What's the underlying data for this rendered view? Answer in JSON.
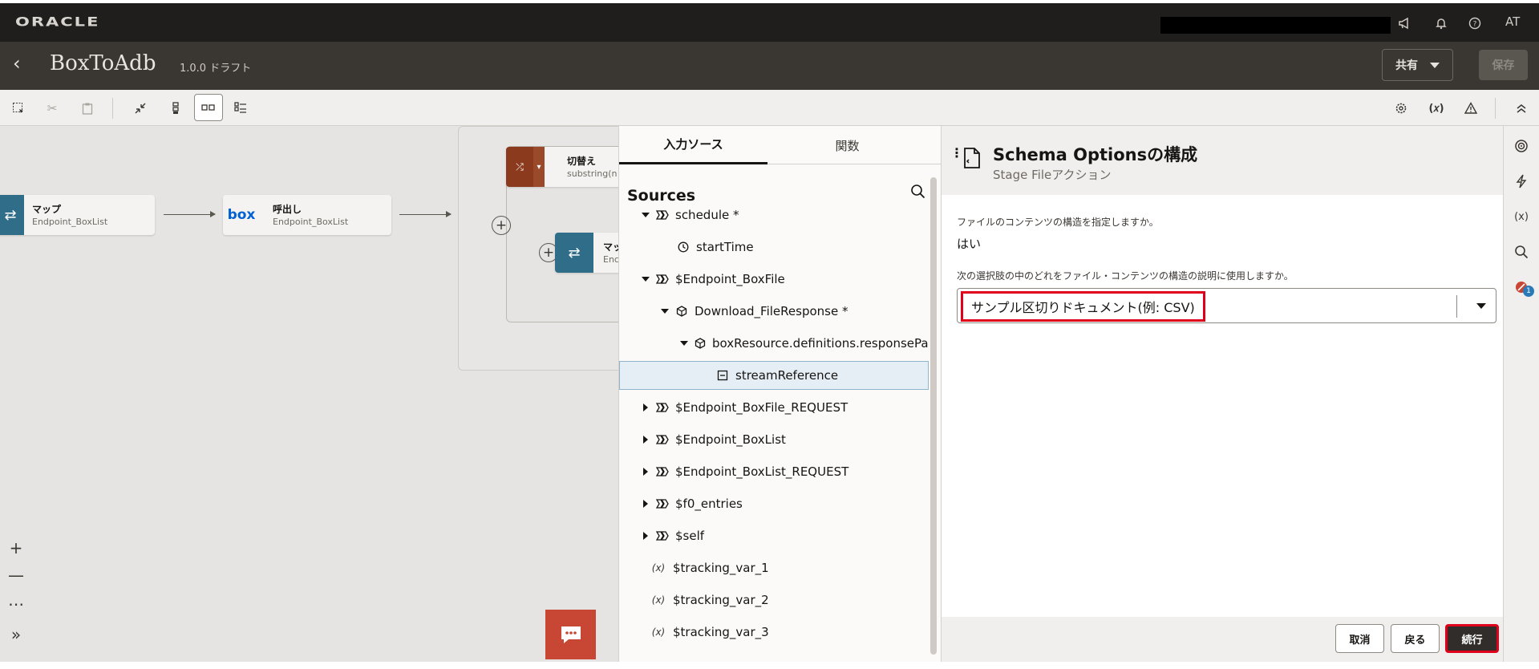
{
  "topbar": {
    "brand": "ORACLE",
    "user_initials": "AT",
    "icons": [
      "megaphone-icon",
      "bell-icon",
      "help-icon"
    ]
  },
  "header": {
    "title": "BoxToAdb",
    "version": "1.0.0 ドラフト",
    "share_label": "共有",
    "save_label": "保存"
  },
  "toolbar": {
    "left_icons": [
      "select-icon",
      "cut-icon",
      "paste-icon",
      "collapse-icon",
      "vertical-layout-icon",
      "horizontal-layout-icon",
      "pseudo-layout-icon"
    ],
    "right_icons": [
      "settings-icon",
      "variables-icon",
      "warning-icon",
      "collapse-up-icon"
    ]
  },
  "canvas": {
    "nodes": [
      {
        "title": "マップ",
        "subtitle": "Endpoint_BoxList",
        "icon": "map-icon",
        "color": "#2f6d88"
      },
      {
        "title": "呼出し",
        "subtitle": "Endpoint_BoxList",
        "icon": "box-logo",
        "color": "#f4f3f2"
      },
      {
        "title": "切替え",
        "subtitle": "substring(n",
        "icon": "switch-icon",
        "color": "#8b3a1e"
      },
      {
        "title": "マッ",
        "subtitle": "Enc",
        "icon": "map-icon",
        "color": "#2f6d88"
      }
    ],
    "box_logo_text": "box",
    "zoom": {
      "in": "+",
      "out": "—",
      "more": "⋯",
      "expand": "»"
    }
  },
  "sources": {
    "tabs": [
      "入力ソース",
      "関数"
    ],
    "active_tab": 0,
    "title": "Sources",
    "tree": [
      {
        "label": "schedule *",
        "depth": 0,
        "expand": "down",
        "icon": "object-icon"
      },
      {
        "label": "startTime",
        "depth": 1,
        "expand": "none",
        "icon": "clock-icon"
      },
      {
        "label": "$Endpoint_BoxFile",
        "depth": 0,
        "expand": "down",
        "icon": "object-icon"
      },
      {
        "label": "Download_FileResponse *",
        "depth": 1,
        "expand": "down",
        "icon": "cube-icon"
      },
      {
        "label": "boxResource.definitions.responsePay",
        "depth": 2,
        "expand": "down",
        "icon": "cube-icon"
      },
      {
        "label": "streamReference",
        "depth": 3,
        "expand": "none",
        "icon": "field-icon",
        "selected": true
      },
      {
        "label": "$Endpoint_BoxFile_REQUEST",
        "depth": 0,
        "expand": "right",
        "icon": "object-icon"
      },
      {
        "label": "$Endpoint_BoxList",
        "depth": 0,
        "expand": "right",
        "icon": "object-icon"
      },
      {
        "label": "$Endpoint_BoxList_REQUEST",
        "depth": 0,
        "expand": "right",
        "icon": "object-icon"
      },
      {
        "label": "$f0_entries",
        "depth": 0,
        "expand": "right",
        "icon": "object-icon"
      },
      {
        "label": "$self",
        "depth": 0,
        "expand": "right",
        "icon": "object-icon"
      },
      {
        "label": "$tracking_var_1",
        "depth": 0,
        "expand": "none",
        "icon": "variable-icon"
      },
      {
        "label": "$tracking_var_2",
        "depth": 0,
        "expand": "none",
        "icon": "variable-icon"
      },
      {
        "label": "$tracking_var_3",
        "depth": 0,
        "expand": "none",
        "icon": "variable-icon"
      }
    ]
  },
  "dialog": {
    "title": "Schema Optionsの構成",
    "subtitle": "Stage Fileアクション",
    "question1": "ファイルのコンテンツの構造を指定しますか。",
    "answer1": "はい",
    "question2": "次の選択肢の中のどれをファイル・コンテンツの構造の説明に使用しますか。",
    "select_value": "サンプル区切りドキュメント(例: CSV)",
    "buttons": {
      "cancel": "取消",
      "back": "戻る",
      "continue": "続行"
    }
  },
  "rail": {
    "icons": [
      "target-icon",
      "lightning-icon",
      "variable-icon",
      "search-icon",
      "error-icon"
    ],
    "variable_text": "(x)",
    "badge_count": "1"
  },
  "colors": {
    "accent_red": "#e0001b",
    "topbar": "#201e1c",
    "header": "#3a3632",
    "chat": "#c74634"
  }
}
